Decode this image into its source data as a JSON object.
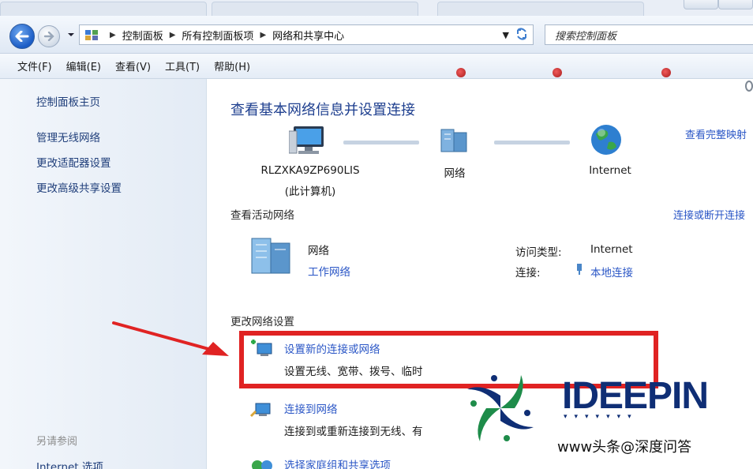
{
  "address_bar": {
    "breadcrumbs": [
      "控制面板",
      "所有控制面板项",
      "网络和共享中心"
    ],
    "search_placeholder": "搜索控制面板"
  },
  "menubar": {
    "items": [
      "文件(F)",
      "编辑(E)",
      "查看(V)",
      "工具(T)",
      "帮助(H)"
    ]
  },
  "left_pane": {
    "home": "控制面板主页",
    "links": [
      "管理无线网络",
      "更改适配器设置",
      "更改高级共享设置"
    ],
    "see_also_heading": "另请参阅",
    "see_also_items": [
      "Internet 选项"
    ]
  },
  "main": {
    "title": "查看基本网络信息并设置连接",
    "view_full_map": "查看完整映射",
    "map": {
      "computer_name": "RLZXKA9ZP690LIS",
      "computer_sub": "(此计算机)",
      "network_label": "网络",
      "internet_label": "Internet"
    },
    "active_networks": {
      "heading": "查看活动网络",
      "connect_disconnect": "连接或断开连接",
      "network_name": "网络",
      "network_type": "工作网络",
      "access_type_label": "访问类型:",
      "access_type_value": "Internet",
      "connections_label": "连接:",
      "connections_value": "本地连接"
    },
    "change_settings": {
      "heading": "更改网络设置",
      "tasks": [
        {
          "title": "设置新的连接或网络",
          "desc": "设置无线、宽带、拨号、临时"
        },
        {
          "title": "连接到网络",
          "desc": "连接到或重新连接到无线、有"
        },
        {
          "title": "选择家庭组和共享选项",
          "desc": ""
        }
      ]
    }
  },
  "watermark": {
    "brand": "IDEEPIN",
    "credit": "www头条@深度问答"
  },
  "colors": {
    "link": "#2a56c6",
    "title": "#1e3f8f",
    "highlight": "#e02323",
    "brand": "#0f2e75"
  }
}
